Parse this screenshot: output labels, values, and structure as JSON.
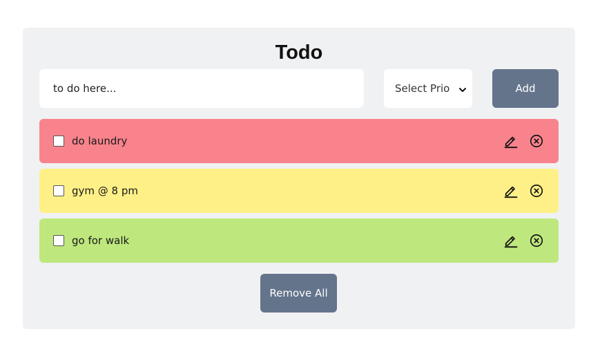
{
  "app": {
    "title": "Todo"
  },
  "form": {
    "input_placeholder": "to do here...",
    "input_value": "",
    "priority_select": {
      "selected_label": "Select Prio"
    },
    "add_label": "Add"
  },
  "todos": [
    {
      "text": "do laundry",
      "checked": false,
      "color": "#f8838c"
    },
    {
      "text": "gym @ 8 pm",
      "checked": false,
      "color": "#fef087"
    },
    {
      "text": "go for walk",
      "checked": false,
      "color": "#bee77d"
    }
  ],
  "icons": {
    "edit": "pencil-icon",
    "delete": "circle-x-icon",
    "select": "chevron-down-icon"
  },
  "footer": {
    "remove_all_label": "Remove All"
  },
  "colors": {
    "card_bg": "#f0f1f3",
    "button_bg": "#64748b",
    "button_text": "#ffffff"
  }
}
